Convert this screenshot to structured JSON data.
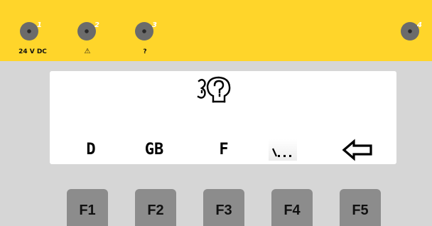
{
  "status_leds": [
    {
      "number": "1",
      "label": "24 V DC"
    },
    {
      "number": "2",
      "label": "⚠"
    },
    {
      "number": "3",
      "label": "?"
    },
    {
      "number": "4",
      "label": ""
    }
  ],
  "display": {
    "glyph_icon": "language-head-question-icon",
    "softkey_labels": [
      "D",
      "GB",
      "F"
    ],
    "more_label_icon": "ellipsis-icon",
    "back_label_icon": "back-arrow-icon"
  },
  "function_keys": [
    "F1",
    "F2",
    "F3",
    "F4",
    "F5"
  ],
  "colors": {
    "panel_yellow": "#ffd52a",
    "housing_gray": "#d6d6d6",
    "display_white": "#ffffff",
    "key_gray": "#8c8c8c",
    "led_gray": "#6b6b6b"
  }
}
